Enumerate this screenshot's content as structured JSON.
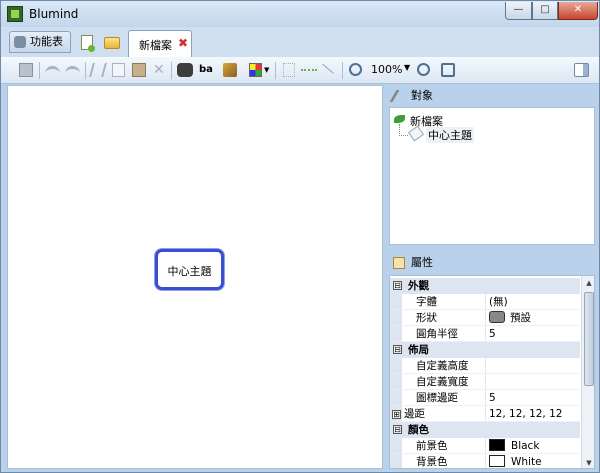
{
  "window": {
    "title": "Blumind",
    "controls": {
      "minimize": "—",
      "maximize": "□",
      "close": "✕"
    }
  },
  "tabs": {
    "menu_label": "功能表",
    "document_tab": "新檔案",
    "close_symbol": "✖"
  },
  "toolbar": {
    "icons": [
      "save-icon",
      "undo-icon",
      "redo-icon",
      "cut-icon",
      "copy-icon",
      "paste-icon",
      "delete-icon",
      "find-icon",
      "replace-icon",
      "format-brush-icon",
      "color-grid-icon",
      "layout-icon",
      "link-icon",
      "line-icon",
      "zoom-out-icon",
      "zoom-in-icon",
      "fit-icon",
      "panel-toggle-icon"
    ],
    "zoom_level": "100%",
    "zoom_caret": "▼"
  },
  "canvas": {
    "central_topic": "中心主題",
    "accent_color": "#3b4ed1"
  },
  "objects_panel": {
    "title": "對象",
    "tree": {
      "root": "新檔案",
      "child": "中心主題"
    }
  },
  "properties_panel": {
    "title": "屬性",
    "categories": [
      {
        "name": "外觀",
        "toggle": "⊟",
        "rows": [
          {
            "name": "字體",
            "value": "(無)"
          },
          {
            "name": "形狀",
            "value": "預設"
          },
          {
            "name": "圓角半徑",
            "value": "5"
          }
        ]
      },
      {
        "name": "佈局",
        "toggle": "⊟",
        "rows": [
          {
            "name": "自定義高度",
            "value": ""
          },
          {
            "name": "自定義寬度",
            "value": ""
          },
          {
            "name": "圖標邊距",
            "value": "5"
          },
          {
            "name": "邊距",
            "value": "12, 12, 12, 12",
            "toggle": "⊞"
          }
        ]
      },
      {
        "name": "顏色",
        "toggle": "⊟",
        "rows": [
          {
            "name": "前景色",
            "value": "Black",
            "swatch": "#000000"
          },
          {
            "name": "背景色",
            "value": "White",
            "swatch": "#ffffff"
          }
        ]
      }
    ]
  }
}
